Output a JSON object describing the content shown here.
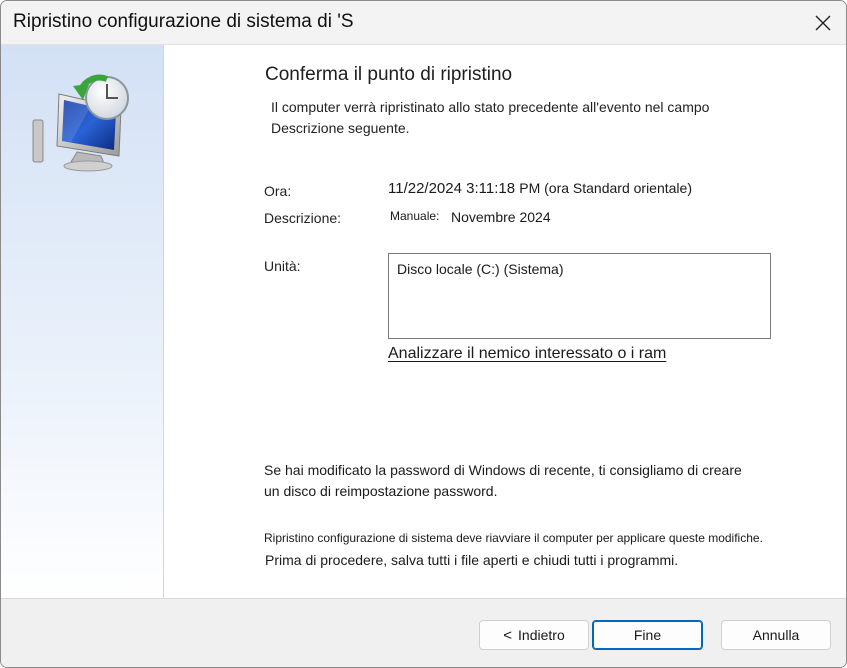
{
  "window": {
    "title": "Ripristino configurazione di sistema di 'S"
  },
  "page": {
    "heading": "Conferma il punto di ripristino",
    "intro": "Il computer verrà ripristinato allo stato precedente all'evento nel campo Descrizione seguente."
  },
  "details": {
    "time_label": "Ora:",
    "time_value": "11/22/2024 3:11:18",
    "time_suffix": "PM (ora Standard orientale)",
    "description_label": "Descrizione:",
    "description_prefix": "Manuale:",
    "description_value": "Novembre 2024",
    "drives_label": "Unità:",
    "drives": [
      "Disco locale (C:) (Sistema)"
    ],
    "scan_link": "Analizzare il nemico interessato o i ram"
  },
  "notes": {
    "password_text": "Se hai modificato la password di Windows di recente, ti consigliamo di creare",
    "password_link": "un disco di reimpostazione password.",
    "restart": "Ripristino configurazione di sistema deve riavviare il computer per applicare queste modifiche.",
    "save": "Prima di procedere, salva tutti i file aperti e chiudi tutti i programmi."
  },
  "footer": {
    "back_arrow": "<",
    "back_label": "Indietro",
    "finish_label": "Fine",
    "cancel_label": "Annulla"
  },
  "icons": {
    "close": "close-icon",
    "system_restore": "system-restore-icon"
  }
}
